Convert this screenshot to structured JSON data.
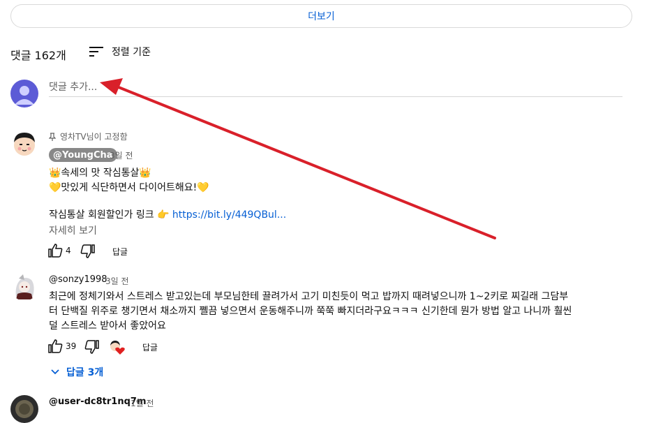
{
  "more_button": "더보기",
  "comments_header": {
    "count_label": "댓글 162개",
    "sort_label": "정렬 기준"
  },
  "add_comment": {
    "placeholder": "댓글 추가..."
  },
  "comments": [
    {
      "pinned_label": "영차TV님이 고정함",
      "author": "@YoungCha",
      "time": "3일 전",
      "lines": [
        "👑속세의 맛 작심통살👑",
        "💛맛있게 식단하면서 다이어트해요!💛",
        "",
        "작심통살 회원할인가 링크 👉"
      ],
      "link": "https://bit.ly/449QBul...",
      "read_more": "자세히 보기",
      "likes": "4",
      "reply_label": "답글"
    },
    {
      "author": "@sonzy1998",
      "time": "3일 전",
      "lines": [
        "최근에 정체기와서 스트레스 받고있는데 부모님한테 끌려가서 고기 미친듯이 먹고 밥까지 때려넣으니까 1~2키로 찌길래 그담부",
        "터 단백질 위주로 챙기면서 채소까지 쪨끔 넣으면서 운동해주니까 쭉쭉 빠지더라구요ㅋㅋㅋ 신기한데 뭔가 방법 알고 나니까 훨씬",
        "덜 스트레스 받아서 좋았어요"
      ],
      "likes": "39",
      "reply_label": "답글",
      "replies_toggle": "답글 3개"
    },
    {
      "author": "@user-dc8tr1nq7m",
      "time": "1일 전"
    }
  ],
  "colors": {
    "link": "#065fd4",
    "arrow": "#d9202a",
    "my_avatar": "#5c5bd6"
  }
}
